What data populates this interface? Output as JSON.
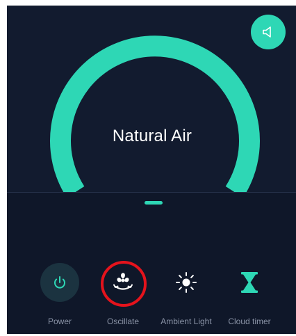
{
  "mode": {
    "label": "Natural Air",
    "ring_color": "#2ed7b5"
  },
  "colors": {
    "background": "#121b2f",
    "accent": "#2ed7b5",
    "label": "#8a93a6",
    "highlight": "#e5131c"
  },
  "sound_button": {
    "icon": "speaker-icon"
  },
  "controls": [
    {
      "id": "power",
      "label": "Power",
      "icon": "power-icon"
    },
    {
      "id": "oscillate",
      "label": "Oscillate",
      "icon": "fan-oscillate-icon",
      "highlighted": true
    },
    {
      "id": "ambient_light",
      "label": "Ambient Light",
      "icon": "sun-icon"
    },
    {
      "id": "cloud_timer",
      "label": "Cloud timer",
      "icon": "hourglass-icon"
    }
  ]
}
